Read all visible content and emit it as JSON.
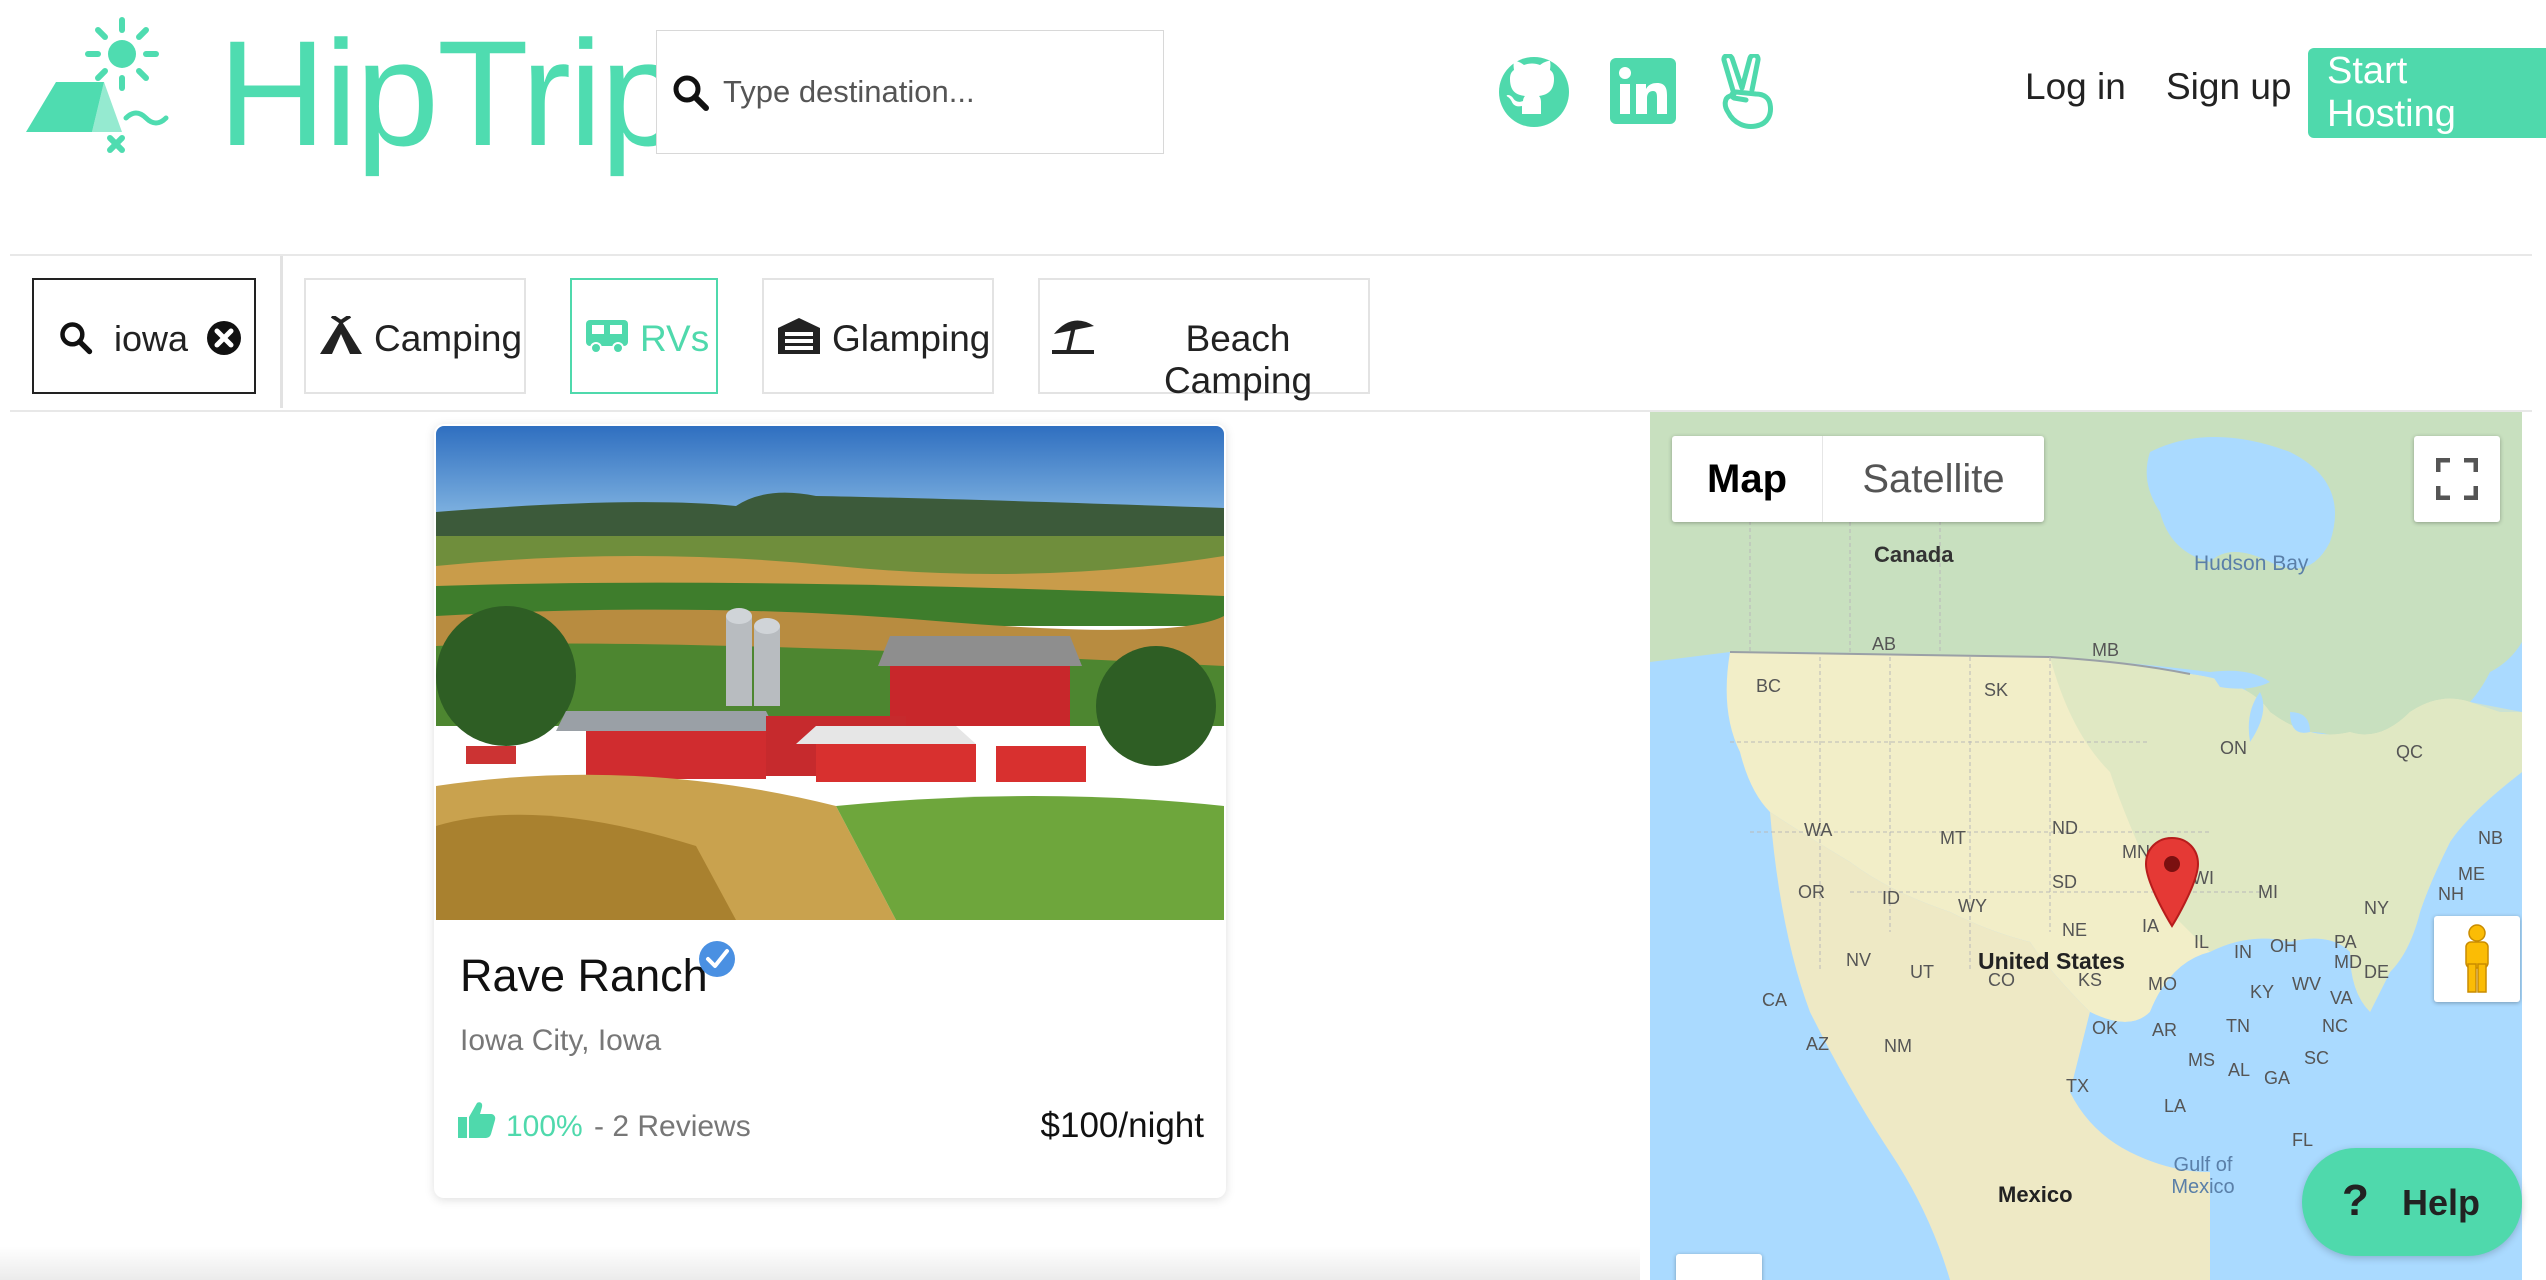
{
  "header": {
    "logo_text": "HipTrip",
    "search_placeholder": "Type destination...",
    "login_label": "Log in",
    "signup_label": "Sign up",
    "host_label": "Start Hosting",
    "social_icons": [
      "github-icon",
      "linkedin-icon",
      "angellist-icon"
    ]
  },
  "filters": {
    "search_value": "iowa",
    "categories": [
      {
        "label": "Camping",
        "icon": "tent-icon",
        "active": false
      },
      {
        "label": "RVs",
        "icon": "rv-icon",
        "active": true
      },
      {
        "label": "Glamping",
        "icon": "garage-icon",
        "active": false
      },
      {
        "label": "Beach Camping",
        "icon": "umbrella-icon",
        "active": false
      }
    ]
  },
  "listing": {
    "title": "Rave Ranch",
    "location": "Iowa City, Iowa",
    "rating": "100%",
    "reviews": "- 2 Reviews",
    "price": "$100/night",
    "verified": true
  },
  "map": {
    "toggle": [
      "Map",
      "Satellite"
    ],
    "selected": "Map",
    "labels": {
      "canada": "Canada",
      "hudson_bay": "Hudson Bay",
      "united_states": "United States",
      "gulf": "Gulf of Mexico",
      "mexico": "Mexico",
      "states": [
        "AB",
        "MB",
        "BC",
        "SK",
        "ON",
        "QC",
        "WA",
        "MT",
        "ND",
        "MN",
        "WI",
        "MI",
        "NB",
        "OR",
        "ID",
        "WY",
        "SD",
        "IA",
        "NY",
        "ME",
        "NH",
        "NV",
        "UT",
        "NE",
        "IL",
        "IN",
        "OH",
        "PA",
        "MD",
        "DE",
        "CA",
        "CO",
        "KS",
        "MO",
        "KY",
        "WV",
        "VA",
        "AZ",
        "NM",
        "OK",
        "AR",
        "TN",
        "NC",
        "SC",
        "TX",
        "MS",
        "AL",
        "GA",
        "LA",
        "FL"
      ]
    },
    "marker": "map-pin-icon"
  },
  "help": {
    "label": "Help",
    "icon": "?"
  },
  "colors": {
    "accent": "#4fd9ac",
    "logo": "#4fdcb0"
  }
}
